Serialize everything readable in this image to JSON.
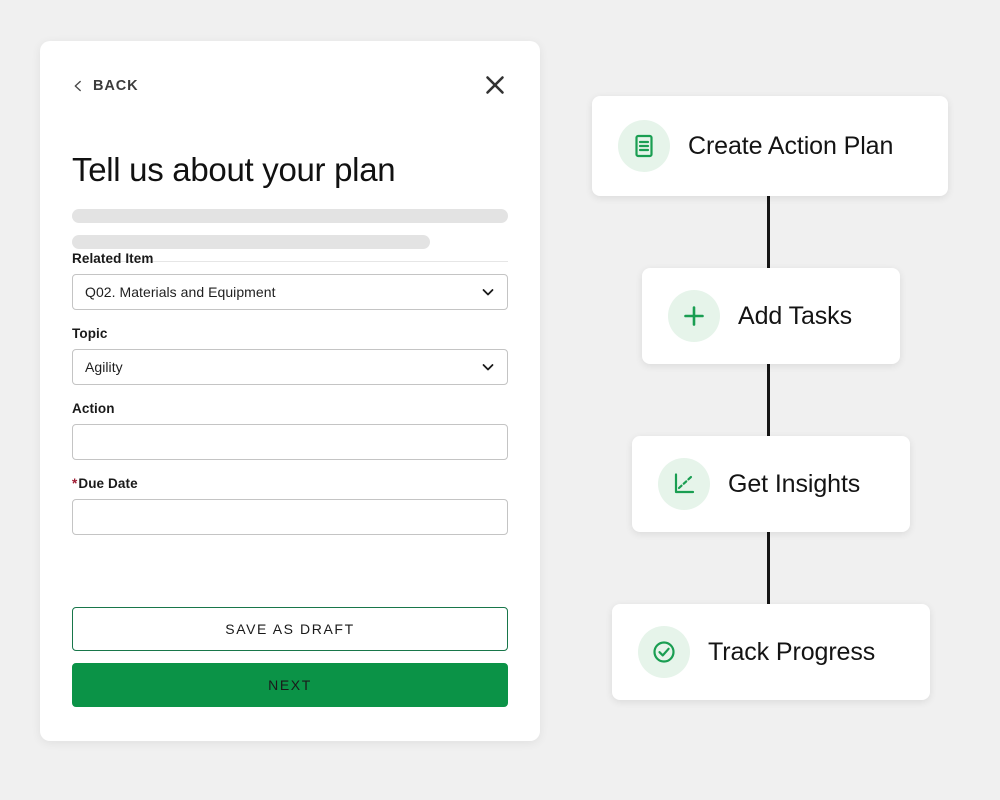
{
  "theme": {
    "page_background": "#f0f0f0",
    "primary_green": "#0b9347",
    "outline_green": "#18764a",
    "icon_green": "#1a9e52",
    "icon_bubble": "#e6f4ea",
    "required_red": "#9e1b32",
    "connector": "#161616"
  },
  "form": {
    "back_label": "BACK",
    "back_icon": "chevron-left-icon",
    "close_icon": "close-icon",
    "title": "Tell us about your plan",
    "fields": [
      {
        "label": "Related Item",
        "required": false,
        "type": "select",
        "value": "Q02. Materials and Equipment",
        "icon": "chevron-down-icon"
      },
      {
        "label": "Topic",
        "required": false,
        "type": "select",
        "value": "Agility",
        "icon": "chevron-down-icon"
      },
      {
        "label": "Action",
        "required": false,
        "type": "text",
        "value": "",
        "placeholder": ""
      },
      {
        "label": "Due Date",
        "required": true,
        "required_marker": "*",
        "type": "text",
        "value": "",
        "placeholder": ""
      }
    ],
    "buttons": {
      "draft_label": "SAVE AS DRAFT",
      "next_label": "NEXT"
    }
  },
  "flow": {
    "steps": [
      {
        "label": "Create Action Plan",
        "icon": "document-list-icon"
      },
      {
        "label": "Add Tasks",
        "icon": "plus-icon"
      },
      {
        "label": "Get Insights",
        "icon": "line-chart-icon"
      },
      {
        "label": "Track Progress",
        "icon": "check-circle-icon"
      }
    ]
  }
}
